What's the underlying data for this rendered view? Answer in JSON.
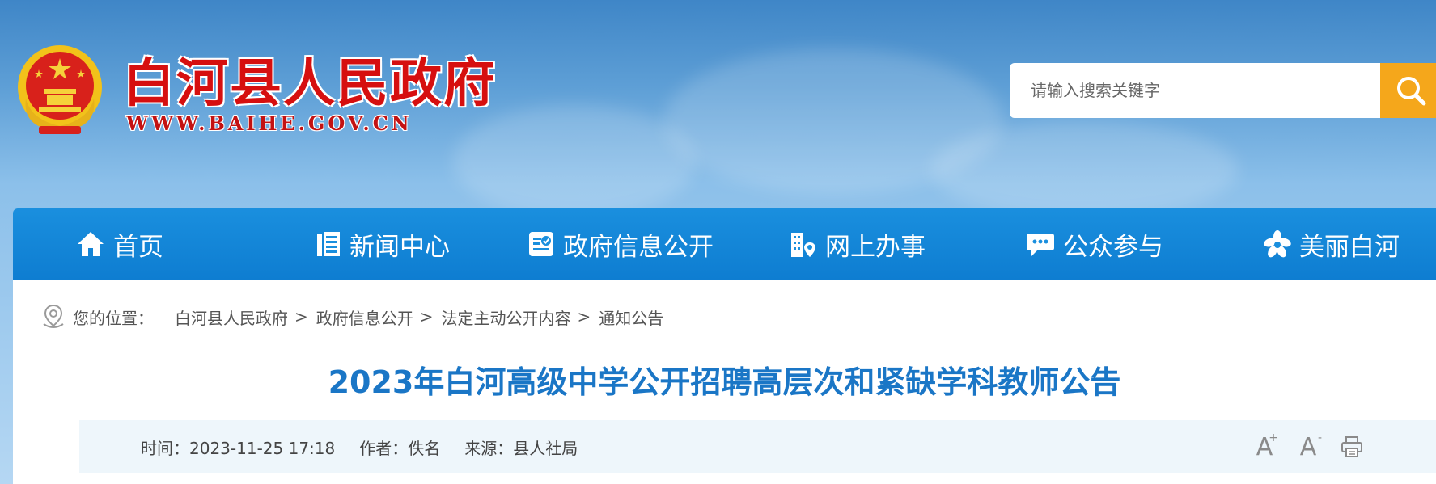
{
  "header": {
    "site_title": "白河县人民政府",
    "site_url": "WWW.BAIHE.GOV.CN",
    "emblem_icon": "national-emblem-icon"
  },
  "search": {
    "placeholder": "请输入搜索关键字",
    "button_icon": "search-icon"
  },
  "nav": {
    "items": [
      {
        "label": "首页",
        "icon": "home-icon"
      },
      {
        "label": "新闻中心",
        "icon": "newspaper-icon"
      },
      {
        "label": "政府信息公开",
        "icon": "info-card-icon"
      },
      {
        "label": "网上办事",
        "icon": "building-location-icon"
      },
      {
        "label": "公众参与",
        "icon": "chat-bubble-icon"
      },
      {
        "label": "美丽白河",
        "icon": "flower-icon"
      }
    ]
  },
  "breadcrumb": {
    "label": "您的位置：",
    "items": [
      "白河县人民政府",
      "政府信息公开",
      "法定主动公开内容",
      "通知公告"
    ],
    "separator": ">"
  },
  "article": {
    "title": "2023年白河高级中学公开招聘高层次和紧缺学科教师公告",
    "time_label": "时间：",
    "time_value": "2023-11-25 17:18",
    "author_label": "作者：",
    "author_value": "佚名",
    "source_label": "来源：",
    "source_value": "县人社局"
  },
  "tools": {
    "increase_font": "A",
    "decrease_font": "A",
    "print_icon": "print-icon"
  },
  "colors": {
    "nav_bg": "#0e7dd1",
    "title_red": "#d60f0f",
    "article_title_blue": "#1a76c6",
    "search_button": "#f5a71b"
  }
}
